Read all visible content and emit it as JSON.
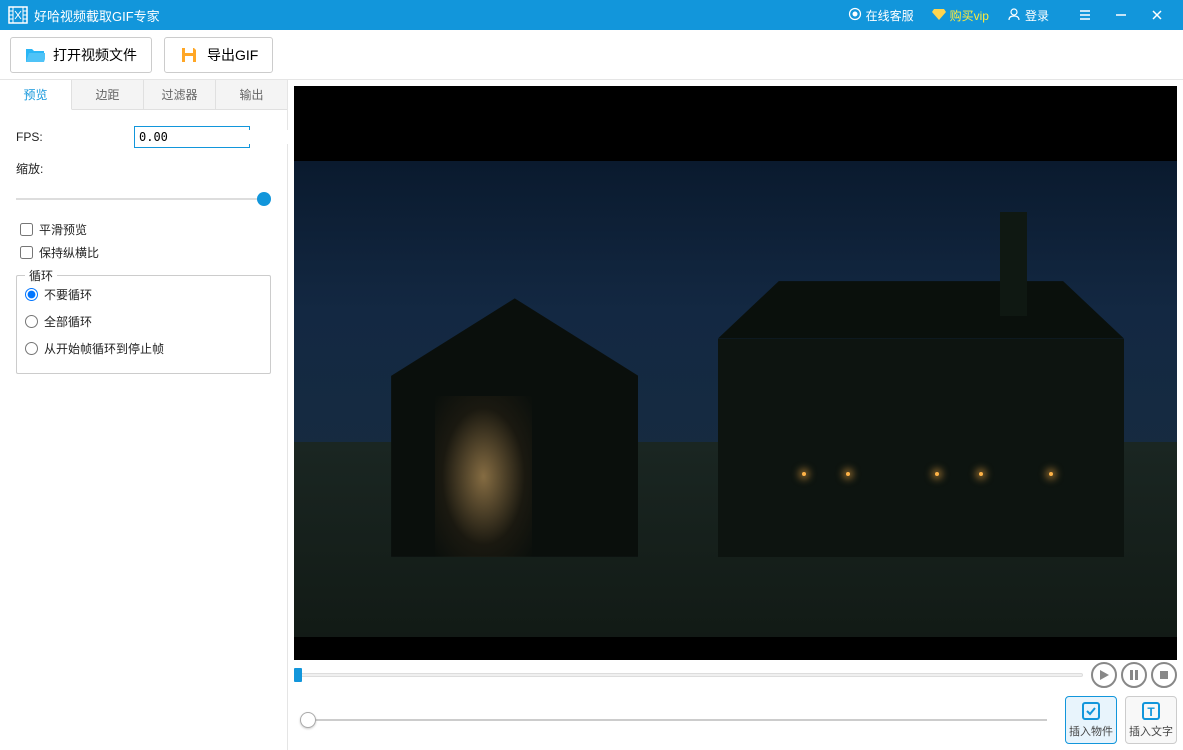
{
  "app": {
    "title": "好哈视频截取GIF专家"
  },
  "titlebar": {
    "support": "在线客服",
    "vip": "购买vip",
    "login": "登录"
  },
  "toolbar": {
    "open_label": "打开视频文件",
    "export_label": "导出GIF"
  },
  "tabs": [
    "预览",
    "边距",
    "过滤器",
    "输出"
  ],
  "panel": {
    "fps_label": "FPS:",
    "fps_value": "0.00",
    "scale_label": "缩放:",
    "smooth_preview": "平滑预览",
    "keep_aspect": "保持纵横比",
    "loop_group": "循环",
    "loop_none": "不要循环",
    "loop_all": "全部循环",
    "loop_range": "从开始帧循环到停止帧"
  },
  "controls": {
    "insert_object": "插入物件",
    "insert_text": "插入文字"
  }
}
